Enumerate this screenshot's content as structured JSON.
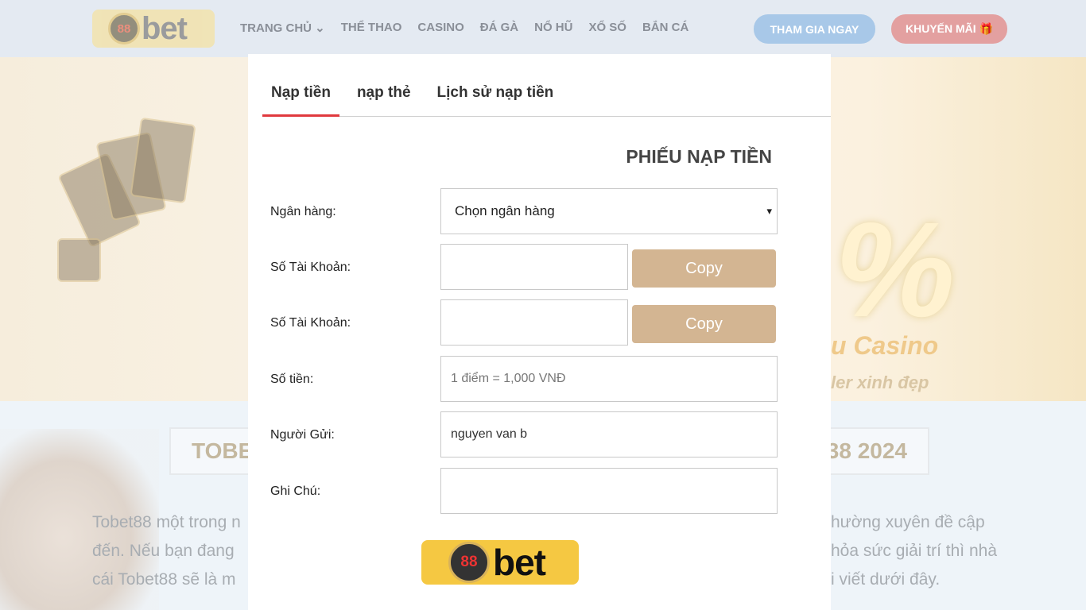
{
  "header": {
    "logo_text": "Tobet 88 casino",
    "nav": [
      "TRANG CHỦ",
      "THỂ THAO",
      "CASINO",
      "ĐÁ GÀ",
      "NỔ HŨ",
      "XỔ SỐ",
      "BẮN CÁ"
    ],
    "join_label": "THAM GIA NGAY",
    "promo_label": "KHUYẾN MÃI 🎁"
  },
  "banner": {
    "percent": "%",
    "casino": "u Casino",
    "dealer": "ler xinh đẹp"
  },
  "article": {
    "title_left": "TOBE",
    "title_right": "38 2024",
    "lines_left": [
      "Tobet88 một trong n",
      "đến. Nếu bạn đang",
      "cái Tobet88 sẽ là m"
    ],
    "lines_right": [
      "hường xuyên đề cập",
      "hỏa sức giải trí thì nhà",
      "i viết dưới đây."
    ]
  },
  "modal": {
    "tabs": [
      "Nạp tiền",
      "nạp thẻ",
      "Lịch sử nạp tiền"
    ],
    "form_title": "PHIẾU NẠP TIỀN",
    "bank_label": "Ngân hàng:",
    "bank_value": "Chọn ngân hàng",
    "account_label_1": "Số Tài Khoản:",
    "account_label_2": "Số Tài Khoản:",
    "copy_label": "Copy",
    "amount_label": "Số tiền:",
    "amount_placeholder": "1 điểm = 1,000 VNĐ",
    "sender_label": "Người Gửi:",
    "sender_value": "nguyen van b",
    "note_label": "Ghi Chú:"
  },
  "colors": {
    "active_tab": "#e0393e",
    "copy_button": "#d3b592",
    "join": "#a8c8e8",
    "promo": "#e3a0a0"
  }
}
